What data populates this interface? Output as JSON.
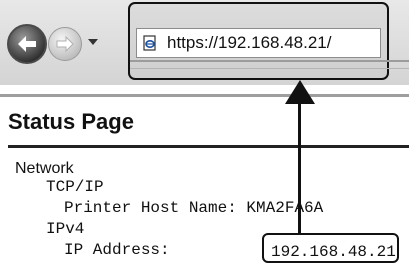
{
  "browser": {
    "url": "https://192.168.48.21/",
    "icons": {
      "back": "back-arrow-icon",
      "forward": "forward-arrow-icon",
      "history_dropdown": "chevron-down-icon",
      "page": "page-icon"
    }
  },
  "page": {
    "title": "Status Page",
    "lines": {
      "network": "Network",
      "tcpip": "TCP/IP",
      "printer_host_name": "Printer Host Name: KMA2FA6A",
      "ipv4": "IPv4",
      "ip_address_label": "IP Address:",
      "ip_address_value": "192.168.48.21"
    }
  }
}
